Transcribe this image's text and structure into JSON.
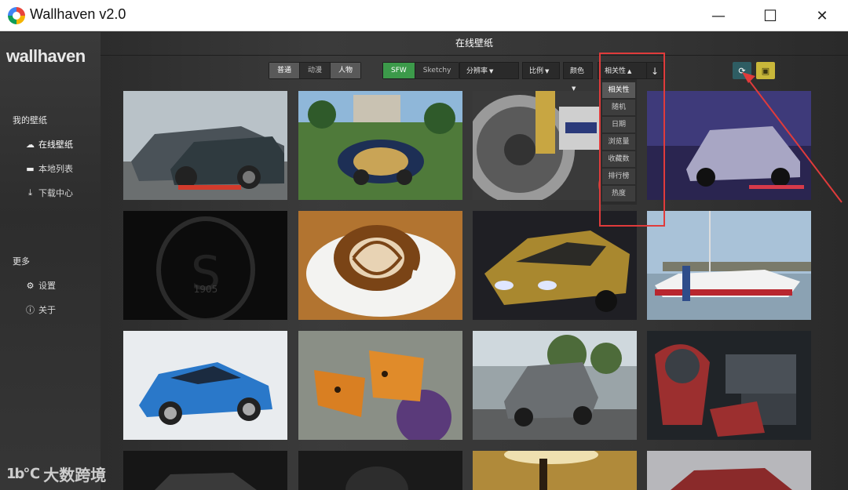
{
  "window": {
    "title": "Wallhaven v2.0",
    "minimize": "—",
    "maximize": "☐",
    "close": "✕"
  },
  "sidebar": {
    "brand": "wallhaven",
    "section1": "我的壁纸",
    "items": [
      {
        "label": "在线壁纸",
        "icon": "cloud-icon"
      },
      {
        "label": "本地列表",
        "icon": "folder-icon"
      },
      {
        "label": "下载中心",
        "icon": "download-icon"
      }
    ],
    "section2": "更多",
    "more": [
      {
        "label": "设置",
        "icon": "gear-icon"
      },
      {
        "label": "关于",
        "icon": "info-icon"
      }
    ]
  },
  "main": {
    "title": "在线壁纸",
    "category": [
      "普通",
      "动漫",
      "人物"
    ],
    "purity": [
      "SFW",
      "Sketchy"
    ],
    "resolution": "分辨率",
    "ratio": "比例",
    "color": "颜色",
    "sort": "相关性",
    "sort_dir_icon": "arrow-down-icon",
    "refresh_icon": "refresh-icon",
    "save_icon": "save-icon",
    "sort_options": [
      "相关性",
      "随机",
      "日期",
      "浏览量",
      "收藏数",
      "排行榜",
      "热度"
    ]
  },
  "thumbnails": [
    "race-cars",
    "bugatti-lawn",
    "motorcycle-brake",
    "hyundai-purple",
    "galatasaray-logo",
    "latte-art",
    "gold-muscle-car",
    "yacht-harbor",
    "volvo-blue",
    "butterfly-thistle",
    "bmw-x6",
    "mech-robot",
    "car-dark",
    "helmet",
    "lamp",
    "sports-car-red"
  ],
  "watermark": {
    "logo": "1b℃",
    "text": "大数跨境"
  },
  "colors": {
    "accent_green": "#3c9a4a",
    "refresh_bg": "#2e5d63",
    "save_bg": "#c9b73a",
    "highlight": "#e03b3b"
  }
}
